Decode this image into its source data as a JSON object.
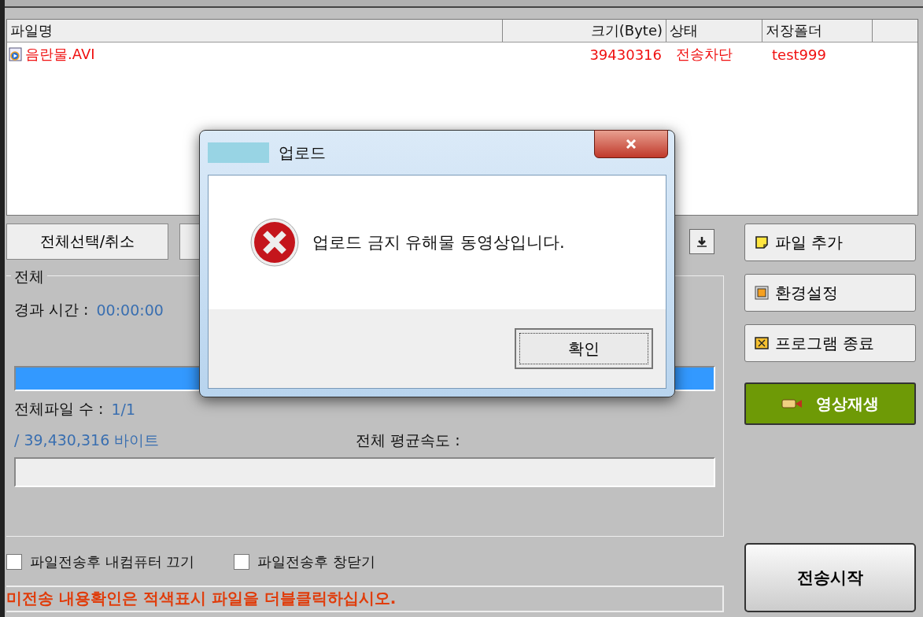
{
  "table": {
    "columns": [
      "파일명",
      "크기(Byte)",
      "상태",
      "저장폴더"
    ],
    "rows": [
      {
        "name": "음란물.AVI",
        "size": "39430316",
        "status": "전송차단",
        "folder": "test999",
        "blocked": true
      }
    ]
  },
  "select_all_button": "전체선택/취소",
  "group": {
    "title": "전체",
    "elapsed_label": "경과 시간 :",
    "elapsed": "00:00:00",
    "progress": {
      "level": 1
    },
    "file_count_label": "전체파일 수 :",
    "file_count": "1/1",
    "bytes": "/ 39,430,316 바이트",
    "speed_label": "전체 평균속도 :"
  },
  "options": [
    {
      "label": "파일전송후 내컴퓨터 끄기",
      "checked": false
    },
    {
      "label": "파일전송후 창닫기",
      "checked": false
    }
  ],
  "message": "미전송 내용확인은 적색표시 파일을 더블클릭하십시오.",
  "side_buttons": [
    {
      "label": "파일 추가",
      "kind": "add"
    },
    {
      "label": "환경설정",
      "kind": "settings"
    },
    {
      "label": "프로그램 종료",
      "kind": "exit"
    },
    {
      "label": "영상재생",
      "kind": "play"
    }
  ],
  "start_button": "전송시작",
  "dialog": {
    "title": "업로드",
    "message": "업로드 금지 유해물 동영상입니다.",
    "ok_button": "확인"
  }
}
